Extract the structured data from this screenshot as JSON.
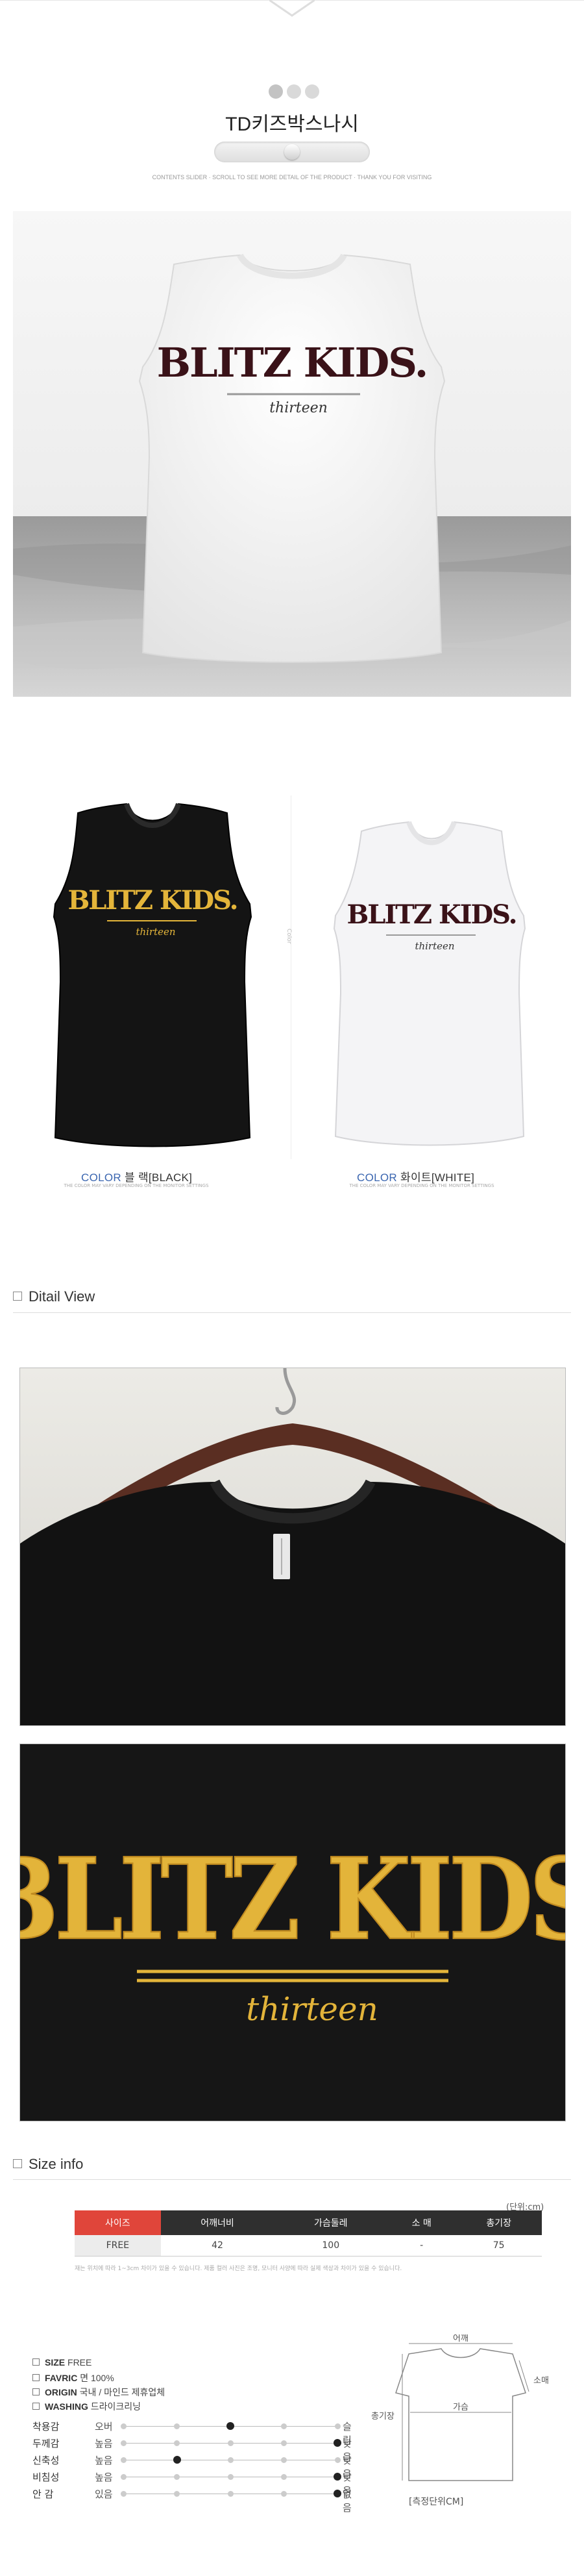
{
  "header": {
    "title": "TD키즈박스나시",
    "slider_caption": "CONTENTS SLIDER · SCROLL TO SEE MORE DETAIL OF THE PRODUCT · THANK YOU FOR VISITING"
  },
  "hero": {
    "print_main": "BLITZ KIDS.",
    "print_script": "thirteen"
  },
  "colors": {
    "black_label_key": "COLOR",
    "black_label_name": "블 랙[BLACK]",
    "white_label_key": "COLOR",
    "white_label_name": "화이트[WHITE]",
    "sub_caption": "THE COLOR MAY VARY DEPENDING ON THE MONITOR SETTINGS",
    "side_text": "Color",
    "print_main": "BLITZ KIDS.",
    "print_script": "thirteen",
    "black_hex": "#141414",
    "white_hex": "#f4f4f6",
    "accent_hex": "#e4b53a"
  },
  "detail": {
    "heading": "Ditail View",
    "print_main": "BLITZ KIDS.",
    "print_script": "thirteen"
  },
  "size_info": {
    "heading": "Size info",
    "unit": "(단위:cm)",
    "columns": [
      "사이즈",
      "어깨너비",
      "가슴둘레",
      "소 매",
      "총기장"
    ],
    "rows": [
      [
        "FREE",
        "42",
        "100",
        "-",
        "75"
      ]
    ],
    "note": "재는 위치에 따라 1~3cm 차이가 있을 수 있습니다. 제품 컬러 사진은 조명, 모니터 사양에 따라 실제 색상과 차이가 있을 수 있습니다."
  },
  "specs": [
    {
      "key": "SIZE",
      "value": "FREE"
    },
    {
      "key": "FAVRIC",
      "value": "면 100%"
    },
    {
      "key": "ORIGIN",
      "value": "국내 / 마인드 제휴업체"
    },
    {
      "key": "WASHING",
      "value": "드라이크리닝"
    }
  ],
  "ratings": [
    {
      "label": "착용감",
      "low": "오버",
      "high": "슬림",
      "level": 2
    },
    {
      "label": "두께감",
      "low": "높음",
      "high": "낮음",
      "level": 4
    },
    {
      "label": "신축성",
      "low": "높음",
      "high": "낮음",
      "level": 1
    },
    {
      "label": "비침성",
      "low": "높음",
      "high": "낮음",
      "level": 4
    },
    {
      "label": "안  감",
      "low": "있음",
      "high": "없음",
      "level": 4
    }
  ],
  "measure": {
    "shoulder": "어깨",
    "chest": "가슴",
    "length": "총기장",
    "sleeve": "소매",
    "caption": "[측정단위CM]"
  }
}
